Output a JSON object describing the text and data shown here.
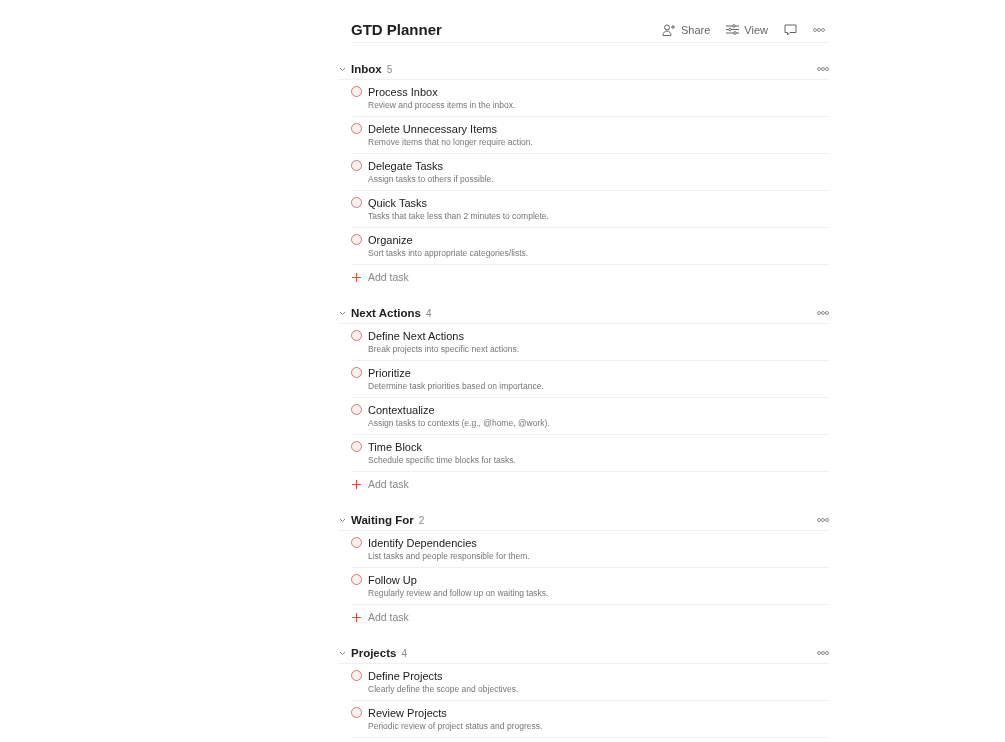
{
  "header": {
    "title": "GTD Planner",
    "actions": [
      {
        "kind": "share",
        "label": "Share"
      },
      {
        "kind": "view",
        "label": "View"
      },
      {
        "kind": "comment"
      },
      {
        "kind": "more"
      }
    ]
  },
  "sections": [
    {
      "name": "Inbox",
      "count": "5",
      "expanded": true,
      "tasks": [
        {
          "title": "Process Inbox",
          "description": "Review and process items in the inbox.",
          "checked": false
        },
        {
          "title": "Delete Unnecessary Items",
          "description": "Remove items that no longer require action.",
          "checked": false
        },
        {
          "title": "Delegate Tasks",
          "description": "Assign tasks to others if possible.",
          "checked": false
        },
        {
          "title": "Quick Tasks",
          "description": "Tasks that take less than 2 minutes to complete.",
          "checked": false
        },
        {
          "title": "Organize",
          "description": "Sort tasks into appropriate categories/lists.",
          "checked": false
        }
      ],
      "add_label": "Add task"
    },
    {
      "name": "Next Actions",
      "count": "4",
      "expanded": true,
      "tasks": [
        {
          "title": "Define Next Actions",
          "description": "Break projects into specific next actions.",
          "checked": false
        },
        {
          "title": "Prioritize",
          "description": "Determine task priorities based on importance.",
          "checked": false
        },
        {
          "title": "Contextualize",
          "description": "Assign tasks to contexts (e.g., @home, @work).",
          "checked": false
        },
        {
          "title": "Time Block",
          "description": "Schedule specific time blocks for tasks.",
          "checked": false
        }
      ],
      "add_label": "Add task"
    },
    {
      "name": "Waiting For",
      "count": "2",
      "expanded": true,
      "tasks": [
        {
          "title": "Identify Dependencies",
          "description": "List tasks and people responsible for them.",
          "checked": false
        },
        {
          "title": "Follow Up",
          "description": "Regularly review and follow up on waiting tasks.",
          "checked": false
        }
      ],
      "add_label": "Add task"
    },
    {
      "name": "Projects",
      "count": "4",
      "expanded": true,
      "tasks": [
        {
          "title": "Define Projects",
          "description": "Clearly define the scope and objectives.",
          "checked": false
        },
        {
          "title": "Review Projects",
          "description": "Periodic review of project status and progress.",
          "checked": false
        }
      ]
    }
  ]
}
